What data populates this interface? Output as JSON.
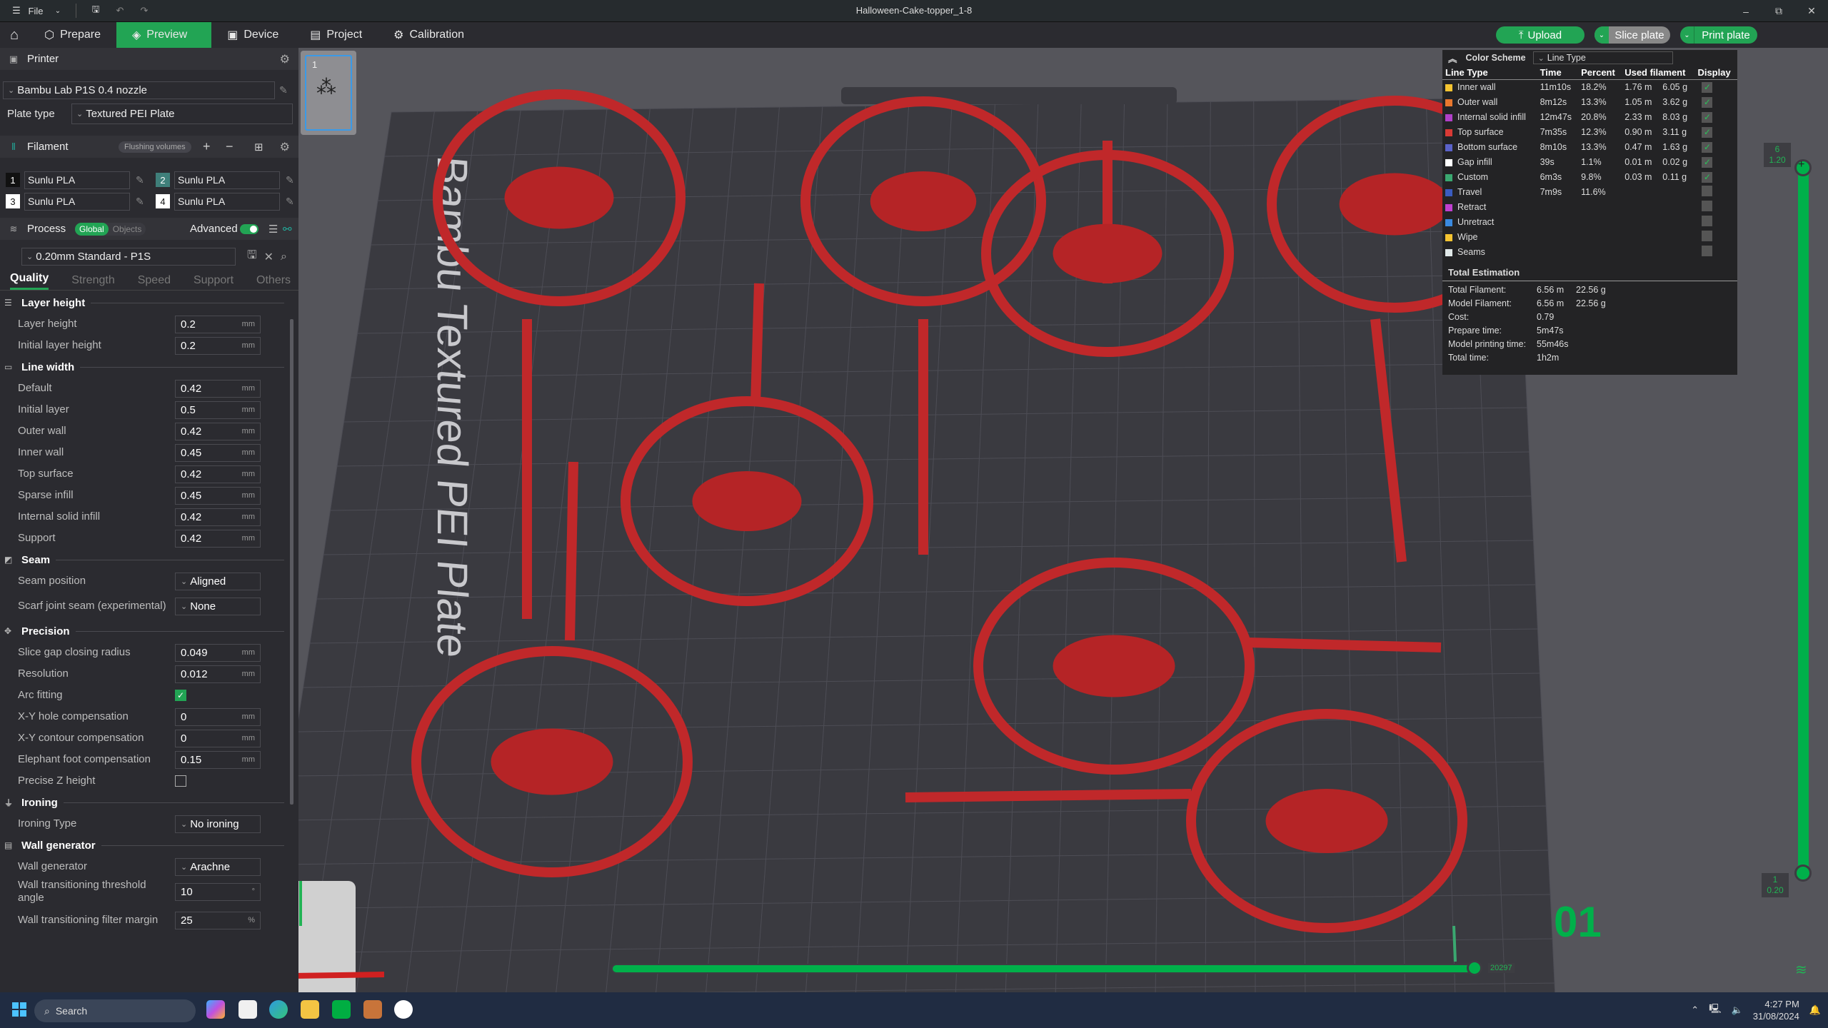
{
  "window": {
    "title": "Halloween-Cake-topper_1-8",
    "menu_label": "File"
  },
  "nav": {
    "tabs": [
      {
        "label": "Prepare",
        "icon": "cube-icon"
      },
      {
        "label": "Preview",
        "icon": "layers-icon",
        "active": true
      },
      {
        "label": "Device",
        "icon": "device-icon"
      },
      {
        "label": "Project",
        "icon": "project-icon"
      },
      {
        "label": "Calibration",
        "icon": "calibration-icon"
      }
    ],
    "upload_label": "Upload",
    "slice_label": "Slice plate",
    "print_label": "Print plate"
  },
  "printer": {
    "section_label": "Printer",
    "printer_name": "Bambu Lab P1S 0.4 nozzle",
    "plate_type_label": "Plate type",
    "plate_type_value": "Textured PEI Plate"
  },
  "filament": {
    "section_label": "Filament",
    "flushing_label": "Flushing volumes",
    "slots": [
      {
        "num": "1",
        "name": "Sunlu PLA",
        "color": "#111111"
      },
      {
        "num": "2",
        "name": "Sunlu PLA",
        "color": "#3f7f7a"
      },
      {
        "num": "3",
        "name": "Sunlu PLA",
        "color": "#ffffff"
      },
      {
        "num": "4",
        "name": "Sunlu PLA",
        "color": "#ffffff"
      }
    ]
  },
  "process": {
    "section_label": "Process",
    "global_label": "Global",
    "objects_label": "Objects",
    "advanced_label": "Advanced",
    "advanced_on": true,
    "preset": "0.20mm Standard - P1S",
    "tabs": [
      "Quality",
      "Strength",
      "Speed",
      "Support",
      "Others"
    ],
    "active_tab": "Quality"
  },
  "groups": {
    "layer_height": {
      "title": "Layer height",
      "opts": [
        {
          "label": "Layer height",
          "value": "0.2",
          "unit": "mm"
        },
        {
          "label": "Initial layer height",
          "value": "0.2",
          "unit": "mm"
        }
      ]
    },
    "line_width": {
      "title": "Line width",
      "opts": [
        {
          "label": "Default",
          "value": "0.42",
          "unit": "mm"
        },
        {
          "label": "Initial layer",
          "value": "0.5",
          "unit": "mm"
        },
        {
          "label": "Outer wall",
          "value": "0.42",
          "unit": "mm"
        },
        {
          "label": "Inner wall",
          "value": "0.45",
          "unit": "mm"
        },
        {
          "label": "Top surface",
          "value": "0.42",
          "unit": "mm"
        },
        {
          "label": "Sparse infill",
          "value": "0.45",
          "unit": "mm"
        },
        {
          "label": "Internal solid infill",
          "value": "0.42",
          "unit": "mm"
        },
        {
          "label": "Support",
          "value": "0.42",
          "unit": "mm"
        }
      ]
    },
    "seam": {
      "title": "Seam",
      "opts": [
        {
          "label": "Seam position",
          "value": "Aligned"
        },
        {
          "label": "Scarf joint seam (experimental)",
          "value": "None"
        }
      ]
    },
    "precision": {
      "title": "Precision",
      "opts": [
        {
          "label": "Slice gap closing radius",
          "value": "0.049",
          "unit": "mm"
        },
        {
          "label": "Resolution",
          "value": "0.012",
          "unit": "mm"
        },
        {
          "label": "Arc fitting",
          "checked": true
        },
        {
          "label": "X-Y hole compensation",
          "value": "0",
          "unit": "mm"
        },
        {
          "label": "X-Y contour compensation",
          "value": "0",
          "unit": "mm"
        },
        {
          "label": "Elephant foot compensation",
          "value": "0.15",
          "unit": "mm"
        },
        {
          "label": "Precise Z height",
          "checked": false
        }
      ]
    },
    "ironing": {
      "title": "Ironing",
      "opts": [
        {
          "label": "Ironing Type",
          "value": "No ironing"
        }
      ]
    },
    "wall_generator": {
      "title": "Wall generator",
      "opts": [
        {
          "label": "Wall generator",
          "value": "Arachne"
        },
        {
          "label": "Wall transitioning threshold angle",
          "value": "10",
          "unit": "°"
        },
        {
          "label": "Wall transitioning filter margin",
          "value": "25",
          "unit": "%"
        }
      ]
    }
  },
  "plate": {
    "thumb_number": "1",
    "bed_label": "Bambu Textured PEI Plate",
    "plate_number": "01"
  },
  "legend": {
    "color_scheme_label": "Color Scheme",
    "color_scheme_value": "Line Type",
    "headers": [
      "Line Type",
      "Time",
      "Percent",
      "Used filament",
      "Display"
    ],
    "rows": [
      {
        "type": "Inner wall",
        "color": "#f5c431",
        "time": "11m10s",
        "percent": "18.2%",
        "length": "1.76 m",
        "weight": "6.05 g",
        "display": true
      },
      {
        "type": "Outer wall",
        "color": "#e8772e",
        "time": "8m12s",
        "percent": "13.3%",
        "length": "1.05 m",
        "weight": "3.62 g",
        "display": true
      },
      {
        "type": "Internal solid infill",
        "color": "#b040c8",
        "time": "12m47s",
        "percent": "20.8%",
        "length": "2.33 m",
        "weight": "8.03 g",
        "display": true
      },
      {
        "type": "Top surface",
        "color": "#d93a35",
        "time": "7m35s",
        "percent": "12.3%",
        "length": "0.90 m",
        "weight": "3.11 g",
        "display": true
      },
      {
        "type": "Bottom surface",
        "color": "#5a62c8",
        "time": "8m10s",
        "percent": "13.3%",
        "length": "0.47 m",
        "weight": "1.63 g",
        "display": true
      },
      {
        "type": "Gap infill",
        "color": "#ffffff",
        "time": "39s",
        "percent": "1.1%",
        "length": "0.01 m",
        "weight": "0.02 g",
        "display": true
      },
      {
        "type": "Custom",
        "color": "#3aa870",
        "time": "6m3s",
        "percent": "9.8%",
        "length": "0.03 m",
        "weight": "0.11 g",
        "display": true
      },
      {
        "type": "Travel",
        "color": "#3a5cc0",
        "time": "7m9s",
        "percent": "11.6%",
        "length": "",
        "weight": "",
        "display": false
      },
      {
        "type": "Retract",
        "color": "#c040d0",
        "time": "",
        "percent": "",
        "length": "",
        "weight": "",
        "display": false
      },
      {
        "type": "Unretract",
        "color": "#3a8ae0",
        "time": "",
        "percent": "",
        "length": "",
        "weight": "",
        "display": false
      },
      {
        "type": "Wipe",
        "color": "#f5c431",
        "time": "",
        "percent": "",
        "length": "",
        "weight": "",
        "display": false
      },
      {
        "type": "Seams",
        "color": "#e0e8e8",
        "time": "",
        "percent": "",
        "length": "",
        "weight": "",
        "display": false
      }
    ],
    "total_title": "Total Estimation",
    "totals": [
      {
        "label": "Total Filament:",
        "v1": "6.56 m",
        "v2": "22.56 g"
      },
      {
        "label": "Model Filament:",
        "v1": "6.56 m",
        "v2": "22.56 g"
      },
      {
        "label": "Cost:",
        "v1": "0.79",
        "v2": ""
      },
      {
        "label": "Prepare time:",
        "v1": "5m47s",
        "v2": ""
      },
      {
        "label": "Model printing time:",
        "v1": "55m46s",
        "v2": ""
      },
      {
        "label": "Total time:",
        "v1": "1h2m",
        "v2": ""
      }
    ]
  },
  "layer_slider": {
    "top_layer": "6",
    "top_height": "1.20",
    "bottom_layer": "1",
    "bottom_height": "0.20"
  },
  "move_slider": {
    "value": "20297"
  },
  "taskbar": {
    "search_placeholder": "Search",
    "time": "4:27 PM",
    "date": "31/08/2024"
  }
}
